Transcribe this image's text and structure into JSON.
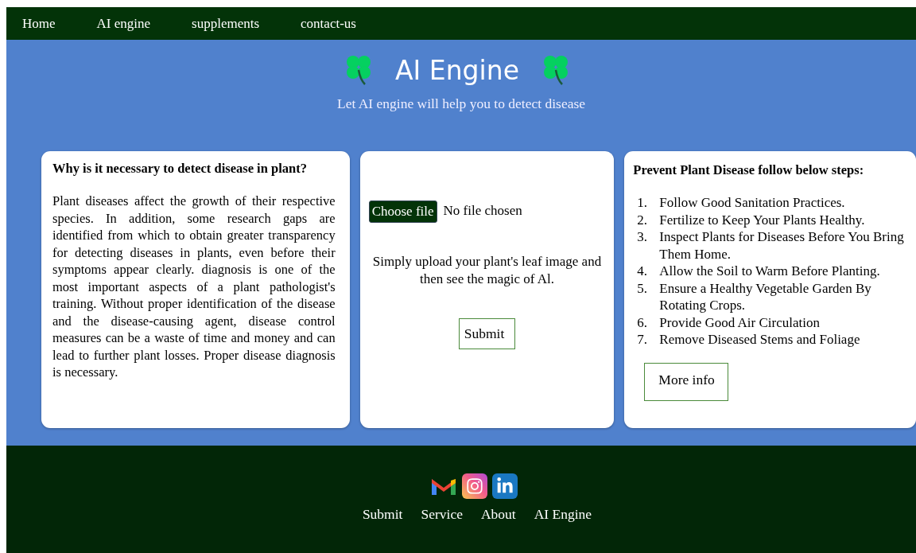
{
  "nav": {
    "links": [
      "Home",
      "AI engine",
      "supplements",
      "contact-us"
    ]
  },
  "hero": {
    "title": "AI Engine",
    "subtitle": "Let AI engine will help you to detect disease"
  },
  "why_card": {
    "heading": "Why is it necessary to detect disease in plant?",
    "body": "Plant diseases affect the growth of their respective species. In addition, some research gaps are identified from which to obtain greater transparency for detecting diseases in plants, even before their symptoms appear clearly. diagnosis is one of the most important aspects of a plant pathologist's training. Without proper identification of the disease and the disease-causing agent, disease control measures can be a waste of time and money and can lead to further plant losses. Proper disease diagnosis is necessary."
  },
  "upload_card": {
    "file_button": "Choose file",
    "file_status": "No file chosen",
    "hint": "Simply upload your plant's leaf image and then see the magic of Al.",
    "submit": "Submit"
  },
  "steps_card": {
    "heading": "Prevent Plant Disease follow below steps:",
    "steps": [
      {
        "number": "1.",
        "text": "Follow Good Sanitation Practices."
      },
      {
        "number": "2.",
        "text": "Fertilize to Keep Your Plants Healthy."
      },
      {
        "number": "3.",
        "text": "Inspect Plants for Diseases Before You Bring Them Home."
      },
      {
        "number": "4.",
        "text": "Allow the Soil to Warm Before Planting."
      },
      {
        "number": "5.",
        "text": "Ensure a Healthy Vegetable Garden By Rotating Crops."
      },
      {
        "number": "6.",
        "text": "Provide Good Air Circulation"
      },
      {
        "number": "7.",
        "text": "Remove Diseased Stems and Foliage"
      }
    ],
    "more": "More info"
  },
  "footer": {
    "social": [
      {
        "kind": "gmail"
      },
      {
        "kind": "instagram"
      },
      {
        "kind": "linkedin"
      }
    ],
    "links": [
      "Submit",
      "Service",
      "About",
      "AI Engine"
    ]
  }
}
